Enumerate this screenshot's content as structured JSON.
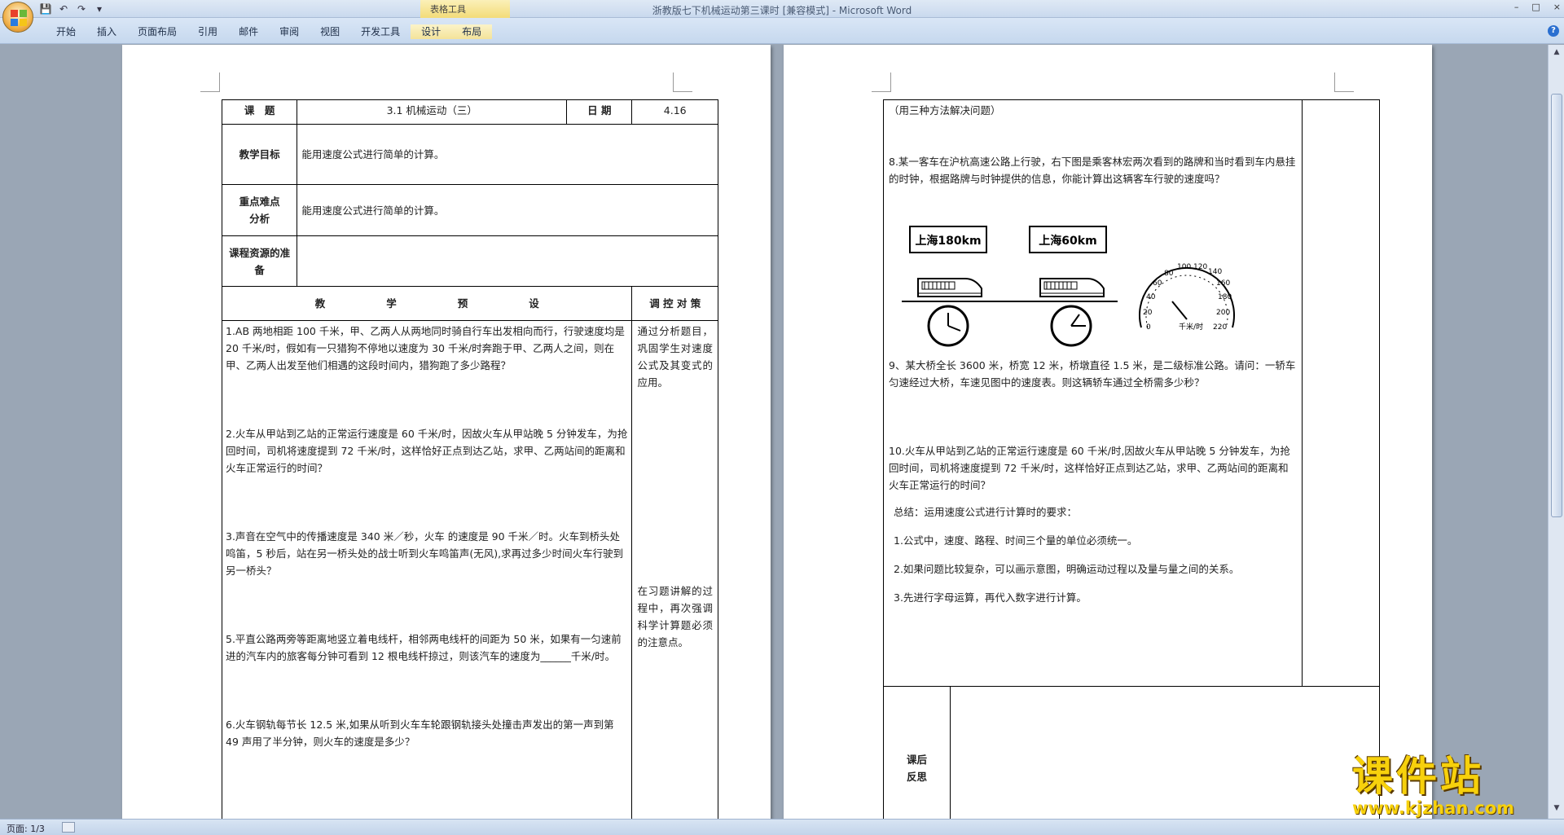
{
  "window": {
    "title": "浙教版七下机械运动第三课时 [兼容模式] - Microsoft Word",
    "context_tab_group": "表格工具",
    "controls": [
      "–",
      "□",
      "×"
    ]
  },
  "ribbon": {
    "tabs": [
      "开始",
      "插入",
      "页面布局",
      "引用",
      "邮件",
      "审阅",
      "视图",
      "开发工具",
      "设计",
      "布局"
    ]
  },
  "status": {
    "page": "页面: 1/3"
  },
  "left_page": {
    "r1": {
      "topic_label": "课　题",
      "topic_value": "3.1 机械运动（三）",
      "date_label": "日 期",
      "date_value": "4.16"
    },
    "r2": {
      "label": "教学目标",
      "value": "能用速度公式进行简单的计算。"
    },
    "r3": {
      "label": "重点难点分析",
      "value": "能用速度公式进行简单的计算。"
    },
    "r4": {
      "label": "课程资源的准备",
      "value": ""
    },
    "r5": {
      "left": "教　　　　　　学　　　　　　预　　　　　　设",
      "right": "调 控 对 策"
    },
    "questions": [
      "1.AB 两地相距 100 千米，甲、乙两人从两地同时骑自行车出发相向而行，行驶速度均是 20 千米/时，假如有一只猎狗不停地以速度为 30 千米/时奔跑于甲、乙两人之间，则在甲、乙两人出发至他们相遇的这段时间内，猎狗跑了多少路程？",
      "2.火车从甲站到乙站的正常运行速度是 60 千米/时，因故火车从甲站晚 5 分钟发车，为抢回时间，司机将速度提到 72 千米/时，这样恰好正点到达乙站，求甲、乙两站间的距离和火车正常运行的时间？",
      "3.声音在空气中的传播速度是 340 米／秒，火车 的速度是 90 千米／时。火车到桥头处鸣笛，5 秒后，站在另一桥头处的战士听到火车鸣笛声(无风),求再过多少时间火车行驶到另一桥头？",
      "5.平直公路两旁等距离地竖立着电线杆，相邻两电线杆的间距为 50 米，如果有一匀速前进的汽车内的旅客每分钟可看到 12 根电线杆掠过，则该汽车的速度为______千米/时。",
      "6.火车钢轨每节长 12.5 米,如果从听到火车车轮跟钢轨接头处撞击声发出的第一声到第 49 声用了半分钟，则火车的速度是多少？"
    ],
    "strategy1": "通过分析题目，巩固学生对速度公式及其变式的应用。",
    "strategy2": "在习题讲解的过程中，再次强调科学计算题必须的注意点。"
  },
  "right_page": {
    "intro": "（用三种方法解决问题）",
    "q8": "8.某一客车在沪杭高速公路上行驶，右下图是乘客林宏两次看到的路牌和当时看到车内悬挂的时钟，根据路牌与时钟提供的信息，你能计算出这辆客车行驶的速度吗？",
    "sign1": "上海180km",
    "sign2": "上海60km",
    "gauge_unit": "千米/时",
    "gauge_ticks": [
      "0",
      "20",
      "40",
      "60",
      "80",
      "100",
      "120",
      "140",
      "160",
      "180",
      "200",
      "220"
    ],
    "q9": "9、某大桥全长 3600 米，桥宽 12 米，桥墩直径 1.5 米，是二级标准公路。请问：一轿车匀速经过大桥，车速见图中的速度表。则这辆轿车通过全桥需多少秒？",
    "q10": "10.火车从甲站到乙站的正常运行速度是 60 千米/时,因故火车从甲站晚 5 分钟发车，为抢回时间，司机将速度提到 72 千米/时，这样恰好正点到达乙站，求甲、乙两站间的距离和火车正常运行的时间？",
    "summary_title": "总结：运用速度公式进行计算时的要求：",
    "summary": [
      "1.公式中，速度、路程、时间三个量的单位必须统一。",
      "2.如果问题比较复杂，可以画示意图，明确运动过程以及量与量之间的关系。",
      "3.先进行字母运算，再代入数字进行计算。"
    ],
    "reflection_label": "课后反思"
  },
  "watermark": {
    "cn": "课件站",
    "url": "www.kjzhan.com"
  },
  "colors": {
    "watermark": "#f7d10c",
    "ribbon": "#c6d8ee",
    "workspace": "#9aa6b5"
  }
}
